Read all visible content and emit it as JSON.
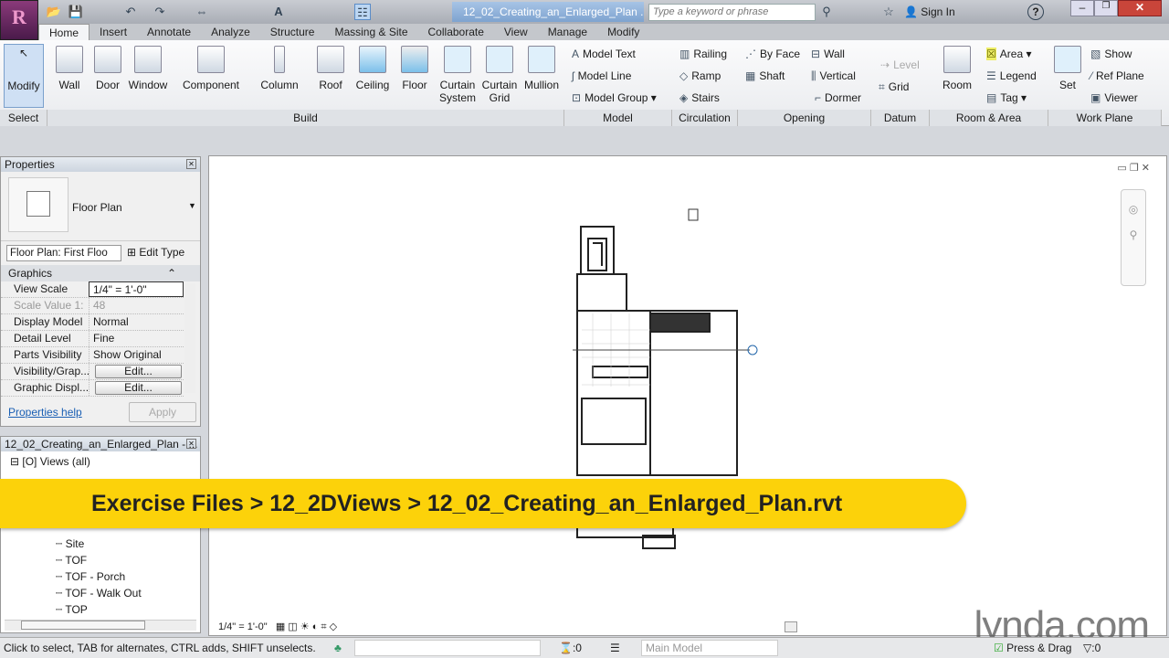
{
  "app": {
    "logo": "R",
    "doc_title": "12_02_Creating_an_Enlarged_Plan ...",
    "search_placeholder": "Type a keyword or phrase",
    "sign_in": "Sign In",
    "help": "?"
  },
  "tabs": [
    "Home",
    "Insert",
    "Annotate",
    "Analyze",
    "Structure",
    "Massing & Site",
    "Collaborate",
    "View",
    "Manage",
    "Modify"
  ],
  "ribbon": {
    "big": [
      {
        "label": "Modify"
      },
      {
        "label": "Wall"
      },
      {
        "label": "Door"
      },
      {
        "label": "Window"
      },
      {
        "label": "Component"
      },
      {
        "label": "Column"
      },
      {
        "label": "Roof"
      },
      {
        "label": "Ceiling"
      },
      {
        "label": "Floor"
      },
      {
        "label": "Curtain System"
      },
      {
        "label": "Curtain Grid"
      },
      {
        "label": "Mullion"
      }
    ],
    "model": [
      "Model Text",
      "Model Line",
      "Model Group"
    ],
    "circulation": [
      "Railing",
      "Ramp",
      "Stairs"
    ],
    "opening": [
      "By Face",
      "Shaft",
      "Wall",
      "Vertical",
      "Dormer"
    ],
    "datum": [
      "Level",
      "Grid"
    ],
    "room": {
      "big": "Room",
      "items": [
        "Area",
        "Legend",
        "Tag"
      ]
    },
    "workplane": {
      "big": "Set",
      "items": [
        "Show",
        "Ref Plane",
        "Viewer"
      ]
    },
    "panels": [
      "Select",
      "Build",
      "Model",
      "Circulation",
      "Opening",
      "Datum",
      "Room & Area",
      "Work Plane"
    ]
  },
  "properties": {
    "title": "Properties",
    "type": "Floor Plan",
    "selector": "Floor Plan: First Floo",
    "edit_type": "Edit Type",
    "section": "Graphics",
    "rows": [
      {
        "k": "View Scale",
        "v": "1/4\" = 1'-0\""
      },
      {
        "k": "Scale Value   1:",
        "v": "48"
      },
      {
        "k": "Display Model",
        "v": "Normal"
      },
      {
        "k": "Detail Level",
        "v": "Fine"
      },
      {
        "k": "Parts Visibility",
        "v": "Show Original"
      },
      {
        "k": "Visibility/Grap...",
        "v": "Edit..."
      },
      {
        "k": "Graphic Displ...",
        "v": "Edit..."
      }
    ],
    "help": "Properties help",
    "apply": "Apply"
  },
  "browser": {
    "title": "12_02_Creating_an_Enlarged_Plan - ...",
    "root": "Views (all)",
    "items": [
      "Site",
      "TOF",
      "TOF - Porch",
      "TOF - Walk Out",
      "TOP"
    ]
  },
  "banner": "Exercise Files > 12_2DViews > 12_02_Creating_an_Enlarged_Plan.rvt",
  "view_bar": {
    "scale": "1/4\" = 1'-0\""
  },
  "status": {
    "hint": "Click to select, TAB for alternates, CTRL adds, SHIFT unselects.",
    "count1": ":0",
    "model": "Main Model",
    "press_drag": "Press & Drag",
    "filter": ":0"
  },
  "watermark": "lynda.com"
}
